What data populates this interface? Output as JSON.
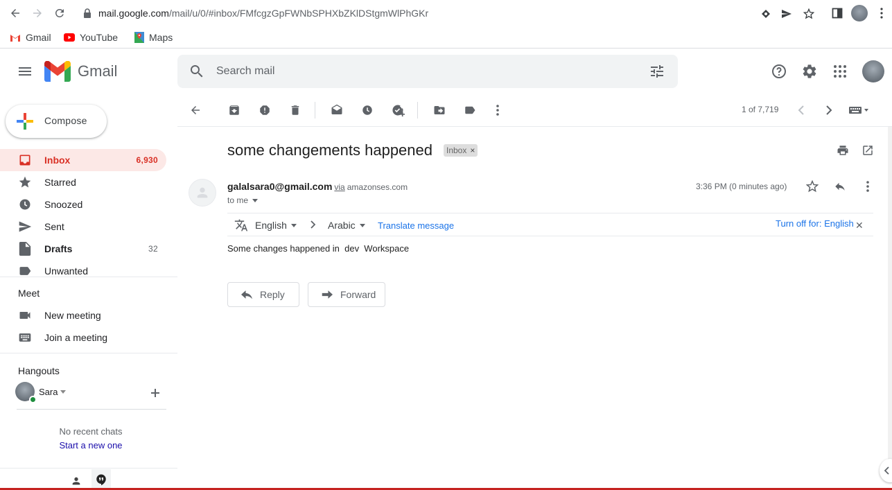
{
  "browser": {
    "url_host": "mail.google.com",
    "url_path": "/mail/u/0/#inbox/FMfcgzGpFWNbSPHXbZKlDStgmWlPhGKr",
    "bookmarks": [
      {
        "label": "Gmail",
        "icon": "gmail-icon"
      },
      {
        "label": "YouTube",
        "icon": "youtube-icon"
      },
      {
        "label": "Maps",
        "icon": "maps-icon"
      }
    ]
  },
  "header": {
    "app_name": "Gmail",
    "search_placeholder": "Search mail"
  },
  "sidebar": {
    "compose_label": "Compose",
    "items": [
      {
        "label": "Inbox",
        "count": "6,930",
        "icon": "inbox-icon",
        "active": true
      },
      {
        "label": "Starred",
        "count": "",
        "icon": "star-icon"
      },
      {
        "label": "Snoozed",
        "count": "",
        "icon": "clock-icon"
      },
      {
        "label": "Sent",
        "count": "",
        "icon": "send-icon"
      },
      {
        "label": "Drafts",
        "count": "32",
        "icon": "draft-icon"
      },
      {
        "label": "Unwanted",
        "count": "",
        "icon": "label-icon"
      }
    ],
    "meet": {
      "title": "Meet",
      "new_meeting": "New meeting",
      "join_meeting": "Join a meeting"
    },
    "hangouts": {
      "title": "Hangouts",
      "user": "Sara",
      "no_chats": "No recent chats",
      "start_new": "Start a new one"
    }
  },
  "toolbar": {
    "page_count": "1 of 7,719"
  },
  "message": {
    "subject": "some changements happened",
    "label": "Inbox",
    "sender_email": "galalsara0@gmail.com",
    "via": "via",
    "via_domain": "amazonses.com",
    "to": "to me",
    "time": "3:36 PM (0 minutes ago)",
    "translate": {
      "from_lang": "English",
      "to_lang": "Arabic",
      "translate_link": "Translate message",
      "turn_off": "Turn off for: English"
    },
    "body": "Some changes happened in  dev  Workspace",
    "reply_label": "Reply",
    "forward_label": "Forward"
  },
  "colors": {
    "accent_red": "#d93025",
    "active_bg": "#fce8e6",
    "link_blue": "#1a73e8"
  }
}
